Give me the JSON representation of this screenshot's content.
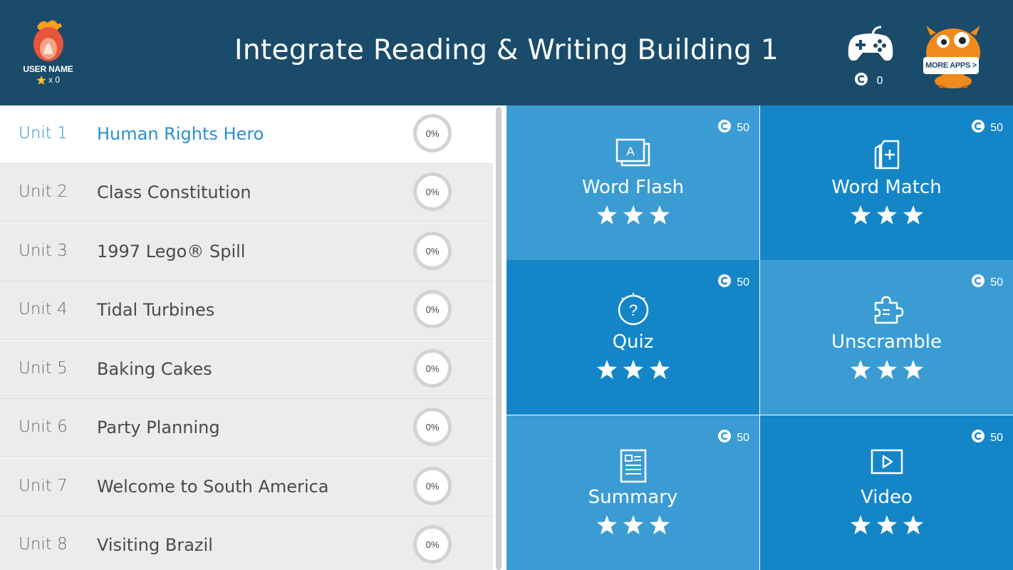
{
  "header": {
    "title": "Integrate Reading & Writing Building 1",
    "user_name": "USER NAME",
    "user_stars": "x 0",
    "game_coins": "0",
    "more_apps_label": "MORE APPS >"
  },
  "units": [
    {
      "num": "Unit 1",
      "name": "Human Rights Hero",
      "progress": "0%",
      "active": true
    },
    {
      "num": "Unit 2",
      "name": "Class Constitution",
      "progress": "0%"
    },
    {
      "num": "Unit 3",
      "name": "1997 Lego® Spill",
      "progress": "0%"
    },
    {
      "num": "Unit 4",
      "name": "Tidal Turbines",
      "progress": "0%"
    },
    {
      "num": "Unit 5",
      "name": "Baking Cakes",
      "progress": "0%"
    },
    {
      "num": "Unit 6",
      "name": "Party Planning",
      "progress": "0%"
    },
    {
      "num": "Unit 7",
      "name": "Welcome to South America",
      "progress": "0%"
    },
    {
      "num": "Unit 8",
      "name": "Visiting Brazil",
      "progress": "0%"
    }
  ],
  "activities": [
    {
      "label": "Word Flash",
      "coins": "50",
      "icon": "word-flash-icon",
      "stars": 3
    },
    {
      "label": "Word Match",
      "coins": "50",
      "icon": "word-match-icon",
      "stars": 3
    },
    {
      "label": "Quiz",
      "coins": "50",
      "icon": "quiz-icon",
      "stars": 3
    },
    {
      "label": "Unscramble",
      "coins": "50",
      "icon": "puzzle-icon",
      "stars": 3
    },
    {
      "label": "Summary",
      "coins": "50",
      "icon": "summary-icon",
      "stars": 3
    },
    {
      "label": "Video",
      "coins": "50",
      "icon": "video-icon",
      "stars": 3
    }
  ],
  "colors": {
    "header_bg": "#1a4b6a",
    "tile_light": "#3b9cd3",
    "tile_dark": "#1486c8",
    "active_text": "#2a8fd0"
  }
}
